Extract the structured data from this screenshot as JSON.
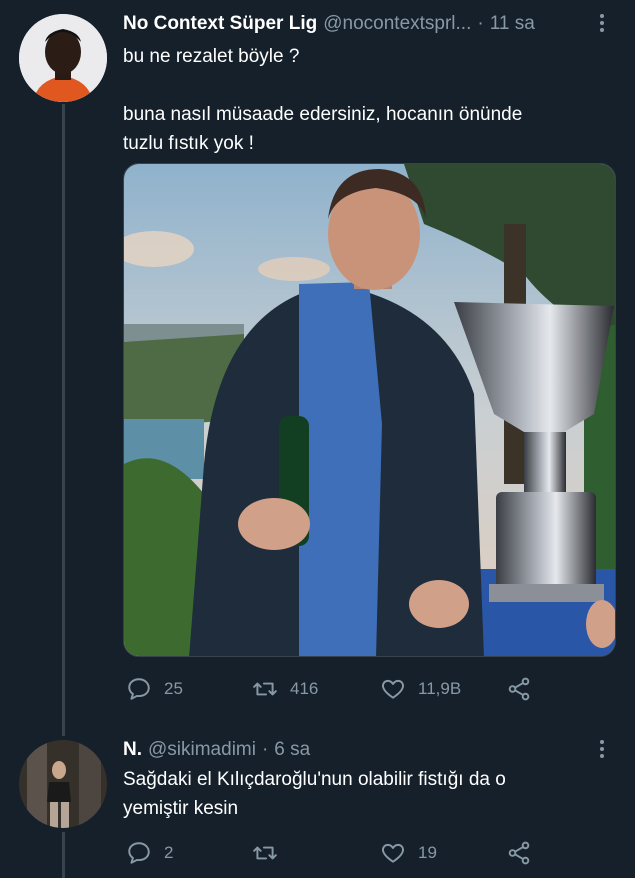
{
  "tweets": [
    {
      "author_name": "No Context Süper Lig",
      "handle": "@nocontextsprl...",
      "separator": "·",
      "time": "11 sa",
      "text": "bu ne rezalet böyle ?\n\nbuna nasıl müsaade edersiniz, hocanın önünde\ntuzlu fıstık yok !",
      "actions": {
        "reply": "25",
        "retweet": "416",
        "like": "11,9B"
      }
    },
    {
      "author_name": "N.",
      "handle": "@sikimadimi",
      "separator": "·",
      "time": "6 sa",
      "text": "Sağdaki el Kılıçdaroğlu'nun olabilir fistığı da o\nyemiştir kesin",
      "actions": {
        "reply": "2",
        "retweet": "",
        "like": "19"
      }
    }
  ],
  "icons": {
    "reply": "reply-icon",
    "retweet": "retweet-icon",
    "like": "heart-icon",
    "share": "share-icon",
    "more": "more-options-icon"
  },
  "colors": {
    "background": "#15202b",
    "text_primary": "#ffffff",
    "text_secondary": "#8899a6",
    "thread_line": "#38444d"
  }
}
